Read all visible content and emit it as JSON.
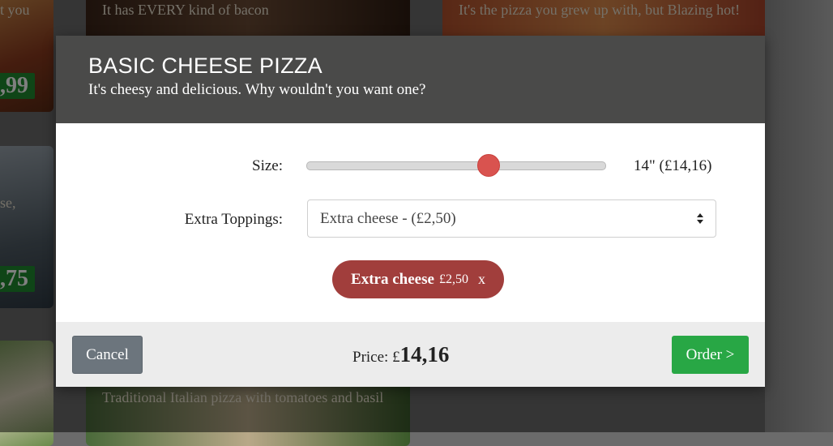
{
  "background": {
    "card1_desc": "t you",
    "card1_price": ",99",
    "card2_desc": "It has EVERY kind of bacon",
    "card3_desc": "It's the pizza you grew up with, but Blazing hot!",
    "card4_desc": "se,",
    "card4_price": ",75",
    "card5_desc": "Traditional Italian pizza with tomatoes and basil"
  },
  "modal": {
    "title": "BASIC CHEESE PIZZA",
    "subtitle": "It's cheesy and delicious. Why wouldn't you want one?",
    "size_label": "Size:",
    "size_value": "14\" (£14,16)",
    "size_level_fraction": 0.61,
    "toppings_label": "Extra Toppings:",
    "toppings_selected": "Extra cheese - (£2,50)",
    "chip": {
      "name": "Extra cheese",
      "price": "£2,50",
      "remove": "x"
    },
    "footer": {
      "cancel_label": "Cancel",
      "price_prefix": "Price: £",
      "price_value": "14,16",
      "order_label": "Order >"
    }
  },
  "colors": {
    "header": "#4a4a49",
    "slider_thumb": "#d9534f",
    "chip": "#a13e3c",
    "cancel": "#6c757d",
    "order": "#28a745"
  }
}
